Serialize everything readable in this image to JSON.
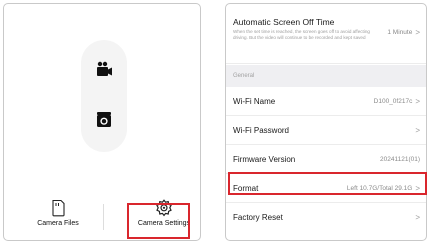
{
  "camera_home": {
    "tabs": {
      "files_label": "Camera Files",
      "settings_label": "Camera Settings"
    },
    "icons": {
      "video_mode": "video-camera-icon",
      "photo_mode": "camera-icon",
      "files": "sd-card-icon",
      "settings": "gear-icon"
    }
  },
  "settings": {
    "auto_off": {
      "title": "Automatic Screen Off Time",
      "description": "When the set time is reached, the screen goes off to avoid affecting driving. But the video will continue to be recorded and kept saved",
      "value": "1 Minute"
    },
    "section_general": "General",
    "rows": [
      {
        "title": "Wi-Fi Name",
        "value": "D100_0f217c"
      },
      {
        "title": "Wi-Fi Password",
        "value": ""
      },
      {
        "title": "Firmware Version",
        "value": "20241121(01)"
      },
      {
        "title": "Format",
        "value": "Left 10.7G/Total 29.1G"
      },
      {
        "title": "Factory Reset",
        "value": ""
      }
    ],
    "chevron": ">"
  },
  "colors": {
    "highlight": "#d9262d",
    "section_bg": "#efeff2",
    "mode_pill_bg": "#f4f4f4"
  }
}
